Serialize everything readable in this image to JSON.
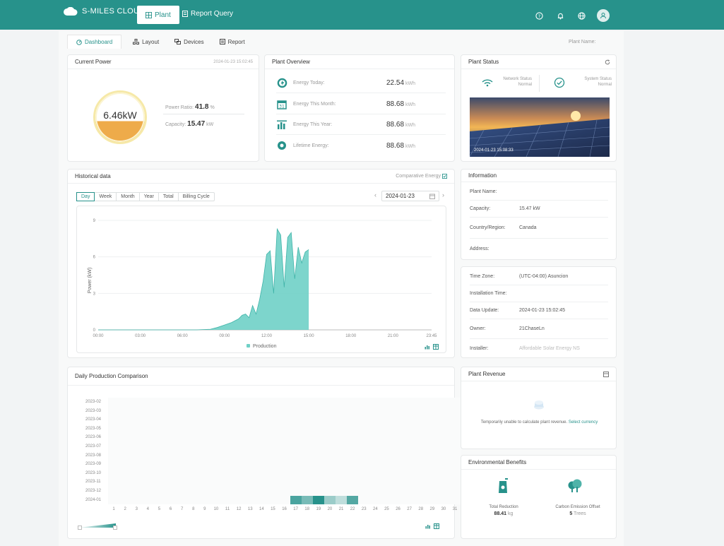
{
  "header": {
    "brand": "S-MILES CLOUD",
    "nav_plant": "Plant",
    "nav_report_query": "Report Query"
  },
  "tabs": [
    {
      "label": "Dashboard",
      "active": true
    },
    {
      "label": "Layout"
    },
    {
      "label": "Devices"
    },
    {
      "label": "Report"
    }
  ],
  "plant_name_label": "Plant Name:",
  "current_power": {
    "title": "Current Power",
    "timestamp": "2024-01-23 15:02:45",
    "value": "6.46kW",
    "fill_fraction": 0.418,
    "power_ratio_label": "Power Ratio:",
    "power_ratio": "41.8",
    "power_ratio_unit": "%",
    "capacity_label": "Capacity:",
    "capacity": "15.47",
    "capacity_unit": "kW"
  },
  "plant_overview": {
    "title": "Plant Overview",
    "rows": [
      {
        "label": "Energy Today:",
        "value": "22.54",
        "unit": "kWh"
      },
      {
        "label": "Energy This Month:",
        "value": "88.68",
        "unit": "kWh"
      },
      {
        "label": "Energy This Year:",
        "value": "88.68",
        "unit": "kWh"
      },
      {
        "label": "Lifetime Energy:",
        "value": "88.68",
        "unit": "kWh"
      }
    ]
  },
  "plant_status": {
    "title": "Plant Status",
    "network_label": "Network Status",
    "network_value": "Normal",
    "system_label": "System Status",
    "system_value": "Normal",
    "photo_timestamp": "2024-01-23 15:08:33"
  },
  "historical": {
    "title": "Historical data",
    "comparative": "Comparative Energy",
    "periods": [
      "Day",
      "Week",
      "Month",
      "Year",
      "Total",
      "Billing Cycle"
    ],
    "date": "2024-01-23"
  },
  "chart_data": {
    "type": "area",
    "ylabel": "Power (kW)",
    "ylim": [
      0,
      9
    ],
    "yticks": [
      "0",
      "3",
      "6",
      "9"
    ],
    "xticks": [
      "00:00",
      "03:00",
      "06:00",
      "09:00",
      "12:00",
      "15:00",
      "18:00",
      "21:00",
      "23:45"
    ],
    "legend": "Production",
    "series": [
      {
        "name": "Production",
        "x": [
          0,
          5,
          7,
          8,
          8.5,
          9,
          9.5,
          10,
          10.25,
          10.5,
          10.75,
          11,
          11.25,
          11.5,
          11.75,
          12,
          12.25,
          12.5,
          12.75,
          13,
          13.25,
          13.5,
          13.75,
          14,
          14.25,
          14.5,
          14.75,
          15
        ],
        "y": [
          0,
          0,
          0,
          0.05,
          0.2,
          0.4,
          0.6,
          0.9,
          1.2,
          1.3,
          1.0,
          2.0,
          1.3,
          2.5,
          4.0,
          6.2,
          6.5,
          3.0,
          8.3,
          7.8,
          3.5,
          7.6,
          8.0,
          4.2,
          6.8,
          5.5,
          6.4,
          6.6
        ]
      }
    ]
  },
  "daily_comparison": {
    "title": "Daily Production Comparison",
    "months": [
      "2023-02",
      "2023-03",
      "2023-04",
      "2023-05",
      "2023-06",
      "2023-07",
      "2023-08",
      "2023-09",
      "2023-10",
      "2023-11",
      "2023-12",
      "2024-01"
    ],
    "days": [
      "1",
      "2",
      "3",
      "4",
      "5",
      "6",
      "7",
      "8",
      "9",
      "10",
      "11",
      "12",
      "13",
      "14",
      "15",
      "16",
      "17",
      "18",
      "19",
      "20",
      "21",
      "22",
      "23",
      "24",
      "25",
      "26",
      "27",
      "28",
      "29",
      "30",
      "31"
    ],
    "highlight": [
      {
        "day": 17,
        "level": 0.8
      },
      {
        "day": 18,
        "level": 0.55
      },
      {
        "day": 19,
        "level": 1.0
      },
      {
        "day": 20,
        "level": 0.35
      },
      {
        "day": 21,
        "level": 0.15
      },
      {
        "day": 22,
        "level": 0.75
      }
    ]
  },
  "information": {
    "title": "Information",
    "rows": [
      {
        "k": "Plant Name:",
        "v": ""
      },
      {
        "k": "Capacity:",
        "v": "15.47 kW"
      },
      {
        "k": "Country/Region:",
        "v": "Canada"
      },
      {
        "k": "Address:",
        "v": ""
      }
    ],
    "rows2": [
      {
        "k": "Time Zone:",
        "v": "(UTC-04:00) Asuncion"
      },
      {
        "k": "Installation Time:",
        "v": ""
      },
      {
        "k": "Data Update:",
        "v": "2024-01-23 15:02:45"
      },
      {
        "k": "Owner:",
        "v": "21ChaseLn"
      },
      {
        "k": "Installer:",
        "v": "Affordable Solar Energy NS"
      }
    ]
  },
  "revenue": {
    "title": "Plant Revenue",
    "message": "Temporarily unable to calculate plant revenue.",
    "link": "Select currency"
  },
  "environment": {
    "title": "Environmental Benefits",
    "reduction_label": "Total Reduction",
    "reduction_value": "88.41",
    "reduction_unit": "kg",
    "carbon_label": "Carbon Emission Offset",
    "carbon_value": "5",
    "carbon_unit": "Trees"
  },
  "colors": {
    "brand": "#27928b",
    "accent": "#6fd0c6",
    "gauge": "#eeab4a"
  }
}
